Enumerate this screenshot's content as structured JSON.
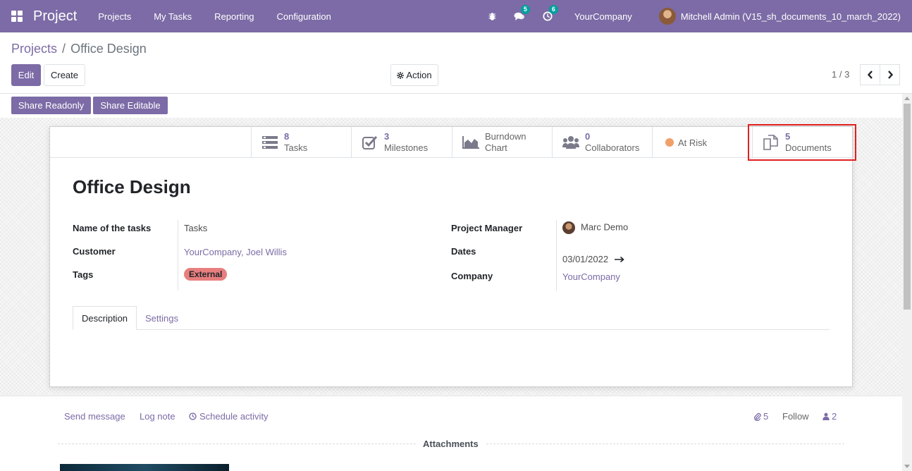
{
  "navbar": {
    "app_title": "Project",
    "menu": [
      "Projects",
      "My Tasks",
      "Reporting",
      "Configuration"
    ],
    "messages_count": "5",
    "activities_count": "6",
    "company": "YourCompany",
    "user": "Mitchell Admin (V15_sh_documents_10_march_2022)"
  },
  "breadcrumb": {
    "parent": "Projects",
    "separator": "/",
    "current": "Office Design"
  },
  "toolbar": {
    "edit": "Edit",
    "create": "Create",
    "action": "Action"
  },
  "pager": {
    "value": "1 / 3"
  },
  "share": {
    "readonly": "Share Readonly",
    "editable": "Share Editable"
  },
  "stats": {
    "tasks": {
      "count": "8",
      "label": "Tasks"
    },
    "milestones": {
      "count": "3",
      "label": "Milestones"
    },
    "burndown": {
      "line1": "Burndown",
      "line2": "Chart"
    },
    "collaborators": {
      "count": "0",
      "label": "Collaborators"
    },
    "status": {
      "label": "At Risk",
      "color": "#f0a06a"
    },
    "documents": {
      "count": "5",
      "label": "Documents"
    }
  },
  "form": {
    "title": "Office Design",
    "fields": {
      "task_name_label": "Name of the tasks",
      "task_name_value": "Tasks",
      "customer_label": "Customer",
      "customer_value": "YourCompany, Joel Willis",
      "tags_label": "Tags",
      "tags_value": "External",
      "manager_label": "Project Manager",
      "manager_value": "Marc Demo",
      "dates_label": "Dates",
      "dates_value": "03/01/2022",
      "company_label": "Company",
      "company_value": "YourCompany"
    },
    "tabs": [
      "Description",
      "Settings"
    ]
  },
  "chatter": {
    "send_message": "Send message",
    "log_note": "Log note",
    "schedule_activity": "Schedule activity",
    "attachments_count": "5",
    "follow": "Follow",
    "followers_count": "2",
    "attachments_label": "Attachments"
  },
  "colors": {
    "brand": "#7c6ba6",
    "tag": "#e87e7e",
    "highlight": "#e02020"
  }
}
